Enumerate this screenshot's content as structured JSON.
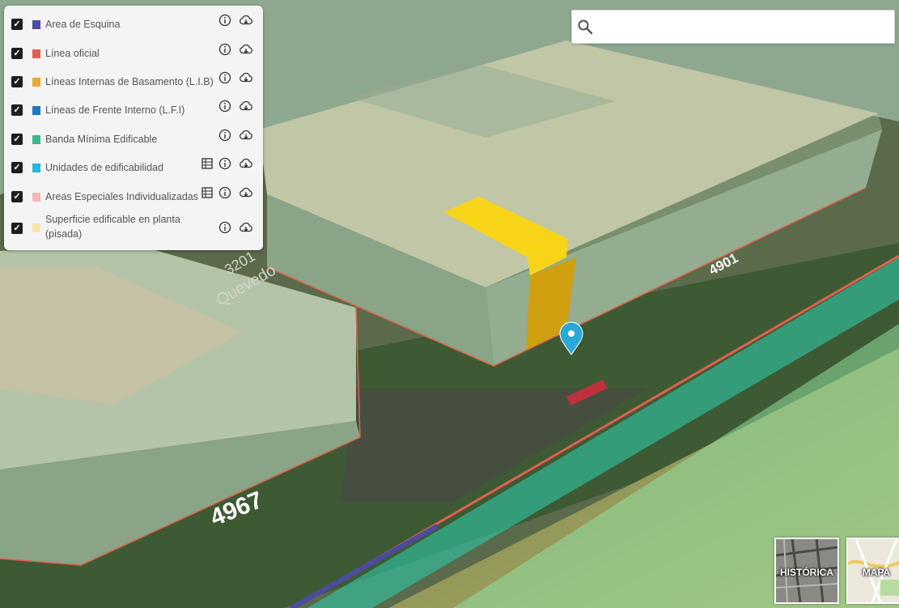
{
  "search": {
    "placeholder": "",
    "value": ""
  },
  "layers": [
    {
      "label": "Area de Esquina",
      "color": "#4b4ba0",
      "checked": true,
      "has_table": false
    },
    {
      "label": "Línea oficial",
      "color": "#e06050",
      "checked": true,
      "has_table": false
    },
    {
      "label": "Líneas Internas de Basamento (L.I.B)",
      "color": "#e8a838",
      "checked": true,
      "has_table": false
    },
    {
      "label": "Líneas de Frente Interno (L.F.I)",
      "color": "#1f78c0",
      "checked": true,
      "has_table": false
    },
    {
      "label": "Banda Mínima Edificable",
      "color": "#3cb890",
      "checked": true,
      "has_table": false
    },
    {
      "label": "Unidades de edificabilidad",
      "color": "#28b8d8",
      "checked": true,
      "has_table": true
    },
    {
      "label": "Areas Especiales Individualizadas",
      "color": "#f4b8b8",
      "checked": true,
      "has_table": true
    },
    {
      "label": "Superficie edificable en planta (pisada)",
      "color": "#f8e4a8",
      "checked": true,
      "has_table": false
    }
  ],
  "map_labels": {
    "street_a": "4901",
    "street_b": "4967",
    "street_c": "3201",
    "street_name": "Quevedo"
  },
  "basemaps": [
    {
      "label": "HISTÓRICA"
    },
    {
      "label": "MAPA"
    }
  ]
}
